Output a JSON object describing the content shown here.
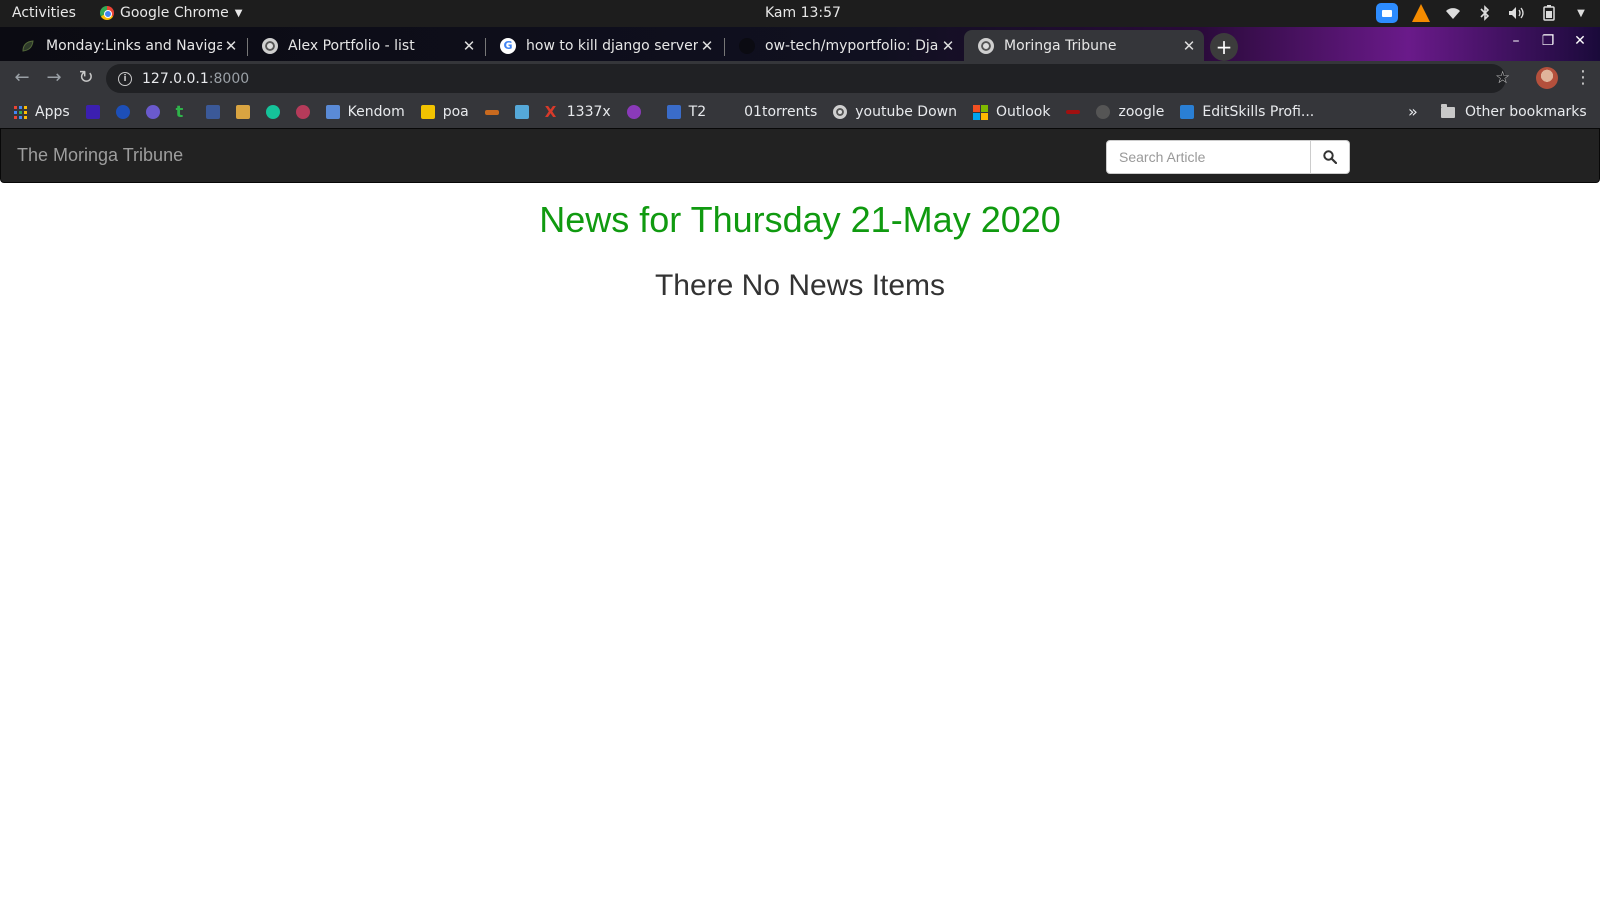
{
  "os_topbar": {
    "activities": "Activities",
    "app_name": "Google Chrome",
    "clock": "Kam 13:57"
  },
  "tabs": [
    {
      "title": "Monday:Links and Naviga",
      "icon": "leaf-icon"
    },
    {
      "title": "Alex Portfolio - list",
      "icon": "globe-icon"
    },
    {
      "title": "how to kill django server &",
      "icon": "google-icon"
    },
    {
      "title": "ow-tech/myportfolio: Dja",
      "icon": "github-icon"
    },
    {
      "title": "Moringa Tribune",
      "icon": "globe-icon",
      "active": true
    }
  ],
  "address_bar": {
    "host": "127.0.0.1",
    "port": ":8000"
  },
  "bookmarks": {
    "apps_label": "Apps",
    "items": [
      {
        "label": "",
        "icon": "star-box-icon",
        "color": "#3b1fb0"
      },
      {
        "label": "",
        "icon": "paypal-icon",
        "color": "#1d4fb8"
      },
      {
        "label": "",
        "icon": "graduation-cap-icon",
        "color": "#6a5acd"
      },
      {
        "label": "",
        "icon": "tumblr-icon",
        "color": "#2fb34a"
      },
      {
        "label": "",
        "icon": "facebook-icon",
        "color": "#3b5998"
      },
      {
        "label": "",
        "icon": "dpk-icon",
        "color": "#d9a441"
      },
      {
        "label": "",
        "icon": "grammarly-icon",
        "color": "#15c39a"
      },
      {
        "label": "",
        "icon": "vpn-icon",
        "color": "#b53b5a"
      },
      {
        "label": "Kendom",
        "icon": "kendom-icon",
        "color": "#5a8ad6"
      },
      {
        "label": "poa",
        "icon": "poa-icon",
        "color": "#f2c300"
      },
      {
        "label": "",
        "icon": "bar-icon",
        "color": "#c96a1f"
      },
      {
        "label": "",
        "icon": "bitly-icon",
        "color": "#55a8d8"
      },
      {
        "label": "1337x",
        "icon": "x-icon",
        "color": "#d83a2a"
      },
      {
        "label": "",
        "icon": "shield-icon",
        "color": "#8a3ab9"
      },
      {
        "label": "T2",
        "icon": "t2-icon",
        "color": "#3a6cc9"
      },
      {
        "label": "01torrents",
        "icon": "blank-icon",
        "color": "#35363a"
      },
      {
        "label": "youtube Down",
        "icon": "globe-icon",
        "color": "#ffffff"
      },
      {
        "label": "Outlook",
        "icon": "microsoft-icon",
        "color": "#f25022"
      },
      {
        "label": "",
        "icon": "red-dot-icon",
        "color": "#a01010"
      },
      {
        "label": "zoogle",
        "icon": "zoogle-icon",
        "color": "#555555"
      },
      {
        "label": "EditSkills Profi...",
        "icon": "editskills-icon",
        "color": "#2a7fd4"
      }
    ],
    "other_label": "Other bookmarks"
  },
  "site": {
    "brand": "The Moringa Tribune",
    "search_placeholder": "Search Article",
    "news_title": "News for Thursday 21-May 2020",
    "empty_message": "There No News Items",
    "accent_color": "#109a10",
    "navbar_color": "#222222"
  }
}
